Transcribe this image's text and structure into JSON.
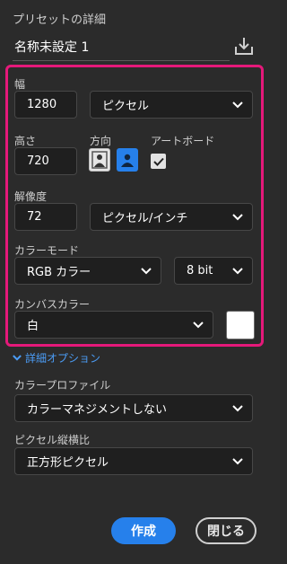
{
  "panel": {
    "section_title": "プリセットの詳細",
    "preset_name": "名称未設定 1"
  },
  "width": {
    "label": "幅",
    "value": "1280",
    "unit": "ピクセル"
  },
  "height": {
    "label": "高さ",
    "value": "720"
  },
  "orientation": {
    "label": "方向",
    "selected": "landscape"
  },
  "artboard": {
    "label": "アートボード",
    "checked": true
  },
  "resolution": {
    "label": "解像度",
    "value": "72",
    "unit": "ピクセル/インチ"
  },
  "color_mode": {
    "label": "カラーモード",
    "mode": "RGB カラー",
    "bit_depth": "8 bit"
  },
  "canvas_color": {
    "label": "カンバスカラー",
    "value": "白",
    "swatch": "#ffffff"
  },
  "advanced": {
    "toggle_label": "詳細オプション"
  },
  "color_profile": {
    "label": "カラープロファイル",
    "value": "カラーマネジメントしない"
  },
  "pixel_aspect": {
    "label": "ピクセル縦横比",
    "value": "正方形ピクセル"
  },
  "buttons": {
    "create": "作成",
    "close": "閉じる"
  },
  "colors": {
    "accent": "#2680eb",
    "highlight": "#e5197a",
    "background": "#2b2b2b"
  },
  "icons": [
    "save-preset-icon",
    "chevron-down-icon",
    "portrait-person-icon",
    "landscape-person-icon",
    "checkmark-icon"
  ]
}
